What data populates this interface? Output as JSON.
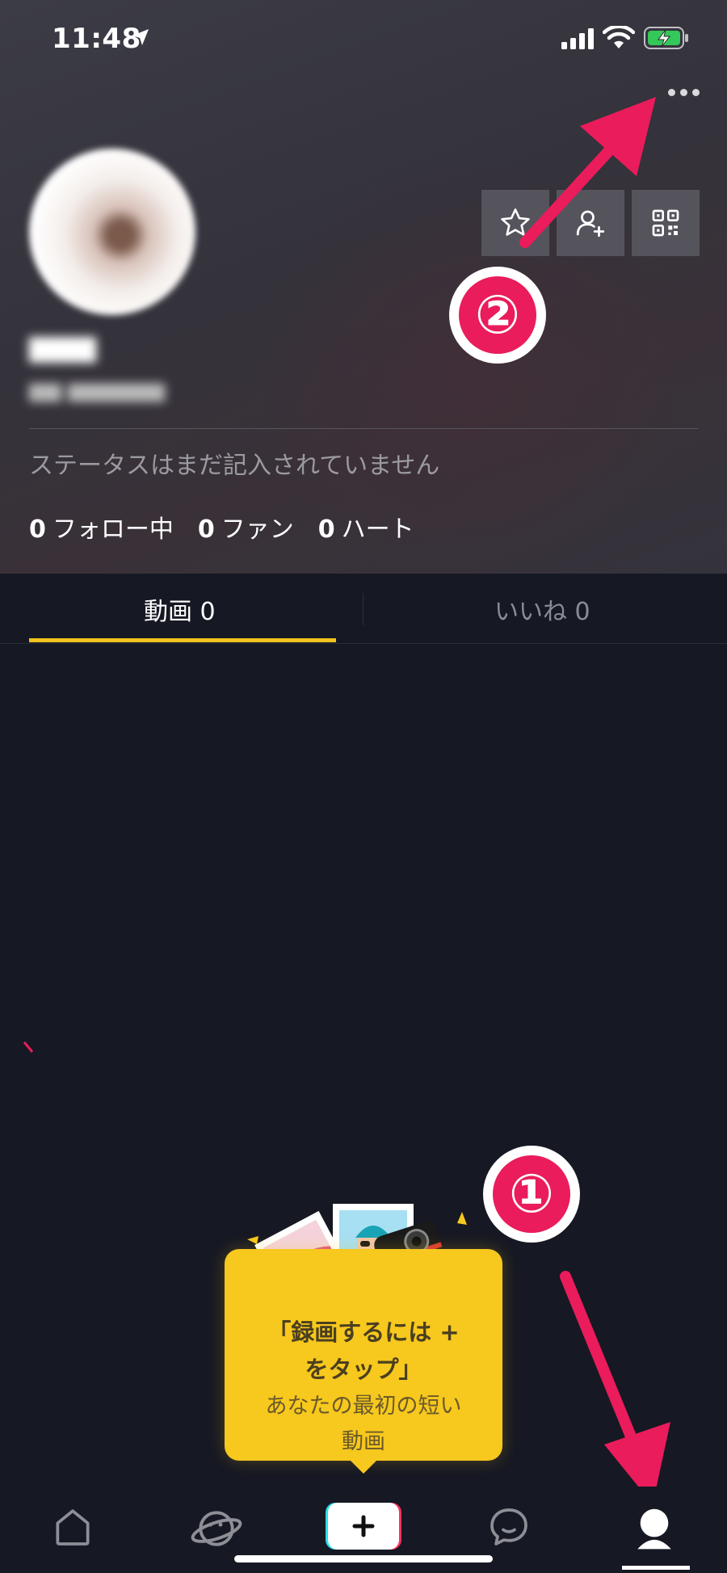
{
  "status_bar": {
    "time": "11:48"
  },
  "profile": {
    "bio": "ステータスはまだ記入されていません",
    "stats": [
      {
        "count": "0",
        "label": "フォロー中"
      },
      {
        "count": "0",
        "label": "ファン"
      },
      {
        "count": "0",
        "label": "ハート"
      }
    ]
  },
  "tabs": [
    {
      "label": "動画 0",
      "active": true
    },
    {
      "label": "いいね 0",
      "active": false
    }
  ],
  "tooltip": {
    "line1": "「録画するには +",
    "line2": "をタップ」",
    "line3": "あなたの最初の短い",
    "line4": "動画"
  },
  "annotations": {
    "first": "①",
    "second": "②"
  },
  "colors": {
    "accent": "#f2c21d",
    "annotation": "#ea1c5b",
    "background": "#161823"
  },
  "icons": [
    "location-arrow-icon",
    "signal-icon",
    "wifi-icon",
    "battery-icon",
    "more-icon",
    "star-icon",
    "add-friend-icon",
    "qr-code-icon",
    "home-icon",
    "discover-icon",
    "plus-icon",
    "messages-icon",
    "profile-icon"
  ]
}
